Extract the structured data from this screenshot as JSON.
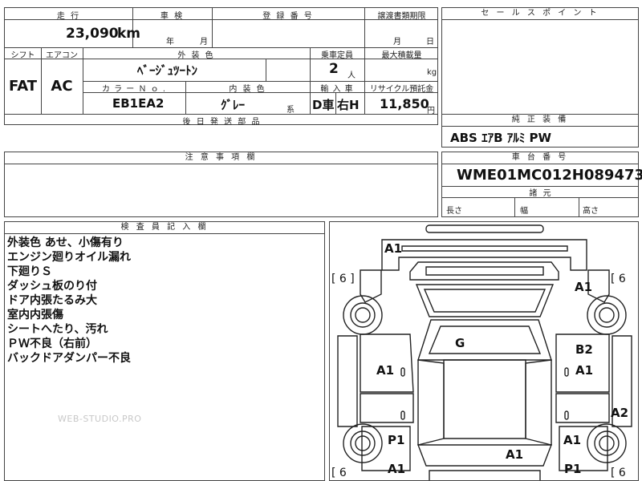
{
  "main_table": {
    "mileage_header": "走 行",
    "mileage_value": "23,090",
    "mileage_unit": "km",
    "inspection_header": "車 検",
    "inspection_year": "年",
    "inspection_month": "月",
    "registration_header": "登 録 番 号",
    "transfer_header": "譲渡書類期限",
    "transfer_month": "月",
    "transfer_day": "日",
    "shift_header": "シフト",
    "aircon_header": "エアコン",
    "exterior_header": "外 装 色",
    "exterior_value": "ﾍﾞｰｼﾞｭﾂｰﾄﾝ",
    "capacity_header": "乗車定員",
    "capacity_value": "2",
    "capacity_unit": "人",
    "maxload_header": "最大積載量",
    "maxload_unit": "kg",
    "shift_value": "FAT",
    "aircon_value": "AC",
    "colorno_header": "カ ラ ー Ｎ ｏ .",
    "colorno_value": "EB1EA2",
    "interior_header": "内 装 色",
    "interior_value": "ｸﾞﾚｰ",
    "interior_suffix": "系",
    "import_header": "輸 入 車",
    "import_value_d": "D車",
    "import_value_h": "右H",
    "recycle_header": "リサイクル預託金",
    "recycle_value": "11,850",
    "recycle_unit": "円",
    "parts_header": "後 日 発 送 部 品"
  },
  "sales_points": {
    "header": "セ ー ル ス ポ イ ン ト"
  },
  "equipment": {
    "header": "純 正 装 備",
    "value": "ABS ｴｱB ｱﾙﾐ PW"
  },
  "notes": {
    "header": "注 意 事 項 欄"
  },
  "chassis": {
    "header": "車 台 番 号",
    "value": "WME01MC012H089473",
    "dims_header": "諸 元",
    "length_label": "長さ",
    "width_label": "幅",
    "height_label": "高さ"
  },
  "inspector": {
    "header": "検 査 員 記 入 欄",
    "lines": [
      "外装色 あせ、小傷有り",
      "エンジン廻りオイル漏れ",
      "下廻りＳ",
      "ダッシュ板のり付",
      "ドア内張たるみ大",
      "室内内張傷",
      "シートへたり、汚れ",
      "ＰＷ不良（右前）",
      "バックドアダンパー不良"
    ]
  },
  "watermark": "WEB-STUDIO.PRO",
  "diagram": {
    "tread_tl": "[ 6 ]",
    "tread_tr": "[ 6",
    "tread_bl": "[ 6",
    "tread_br": "[ 6",
    "marks": {
      "front_bumper": "A1",
      "front_right_fender": "A1",
      "roof": "G",
      "right_front_door": "B2",
      "right_front_door_2": "A1",
      "left_front_door": "A1",
      "right_rear_quarter": "A2",
      "left_rear_fender": "P1",
      "right_rear_fender": "A1",
      "rear_center": "A1",
      "left_rear_bumper": "A1",
      "right_rear_bumper": "P1"
    }
  }
}
